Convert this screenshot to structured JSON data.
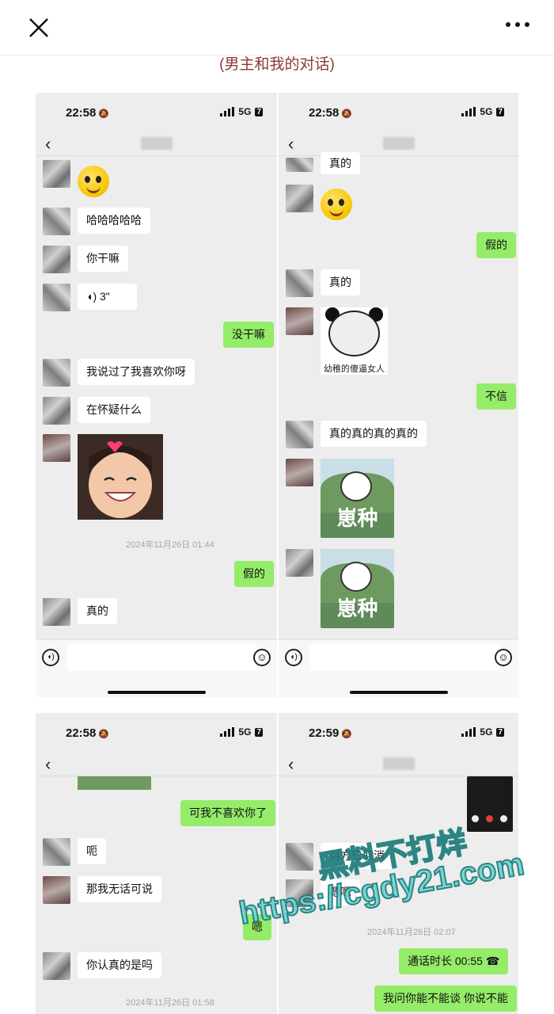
{
  "caption": "(男主和我的对话)",
  "status": {
    "time_1": "22:58",
    "time_2": "22:58",
    "time_3": "22:58",
    "time_4": "22:59",
    "network": "5G",
    "battery": "7"
  },
  "panel1": {
    "m1": "哈哈哈哈哈",
    "m2": "你干嘛",
    "voice": "3\"",
    "m3": "没干嘛",
    "m4": "我说过了我喜欢你呀",
    "m5": "在怀疑什么",
    "ts": "2024年11月26日 01:44",
    "m6": "假的",
    "m7": "真的"
  },
  "panel2": {
    "m1": "真的",
    "m2": "假的",
    "m3": "真的",
    "sticker_caption": "幼稚的傻逼女人",
    "m4": "不信",
    "m5": "真的真的真的真的",
    "bunny_text": "崽种"
  },
  "panel3": {
    "m1": "可我不喜欢你了",
    "m2": "呃",
    "m3": "那我无话可说",
    "m4": "嗯",
    "m5": "你认真的是吗",
    "ts": "2024年11月26日 01:58"
  },
  "panel4": {
    "m1": "对方已取消",
    "m2": "嗯嗯",
    "ts": "2024年11月26日 02:07",
    "call": "通话时长 00:55",
    "m3": "我问你能不能谈 你说不能"
  },
  "watermark": {
    "line1": "黑料不打烊",
    "line2": "https://cgdy21.com"
  },
  "icons": {
    "close": "close-icon",
    "more": "more-icon",
    "voice": "voice-icon",
    "emoji": "emoji-icon",
    "back": "back-icon",
    "phone": "phone-icon"
  },
  "colors": {
    "sent_bubble": "#95ec69",
    "received_bubble": "#ffffff",
    "chat_bg": "#ededed",
    "caption": "#8a3a2f"
  }
}
